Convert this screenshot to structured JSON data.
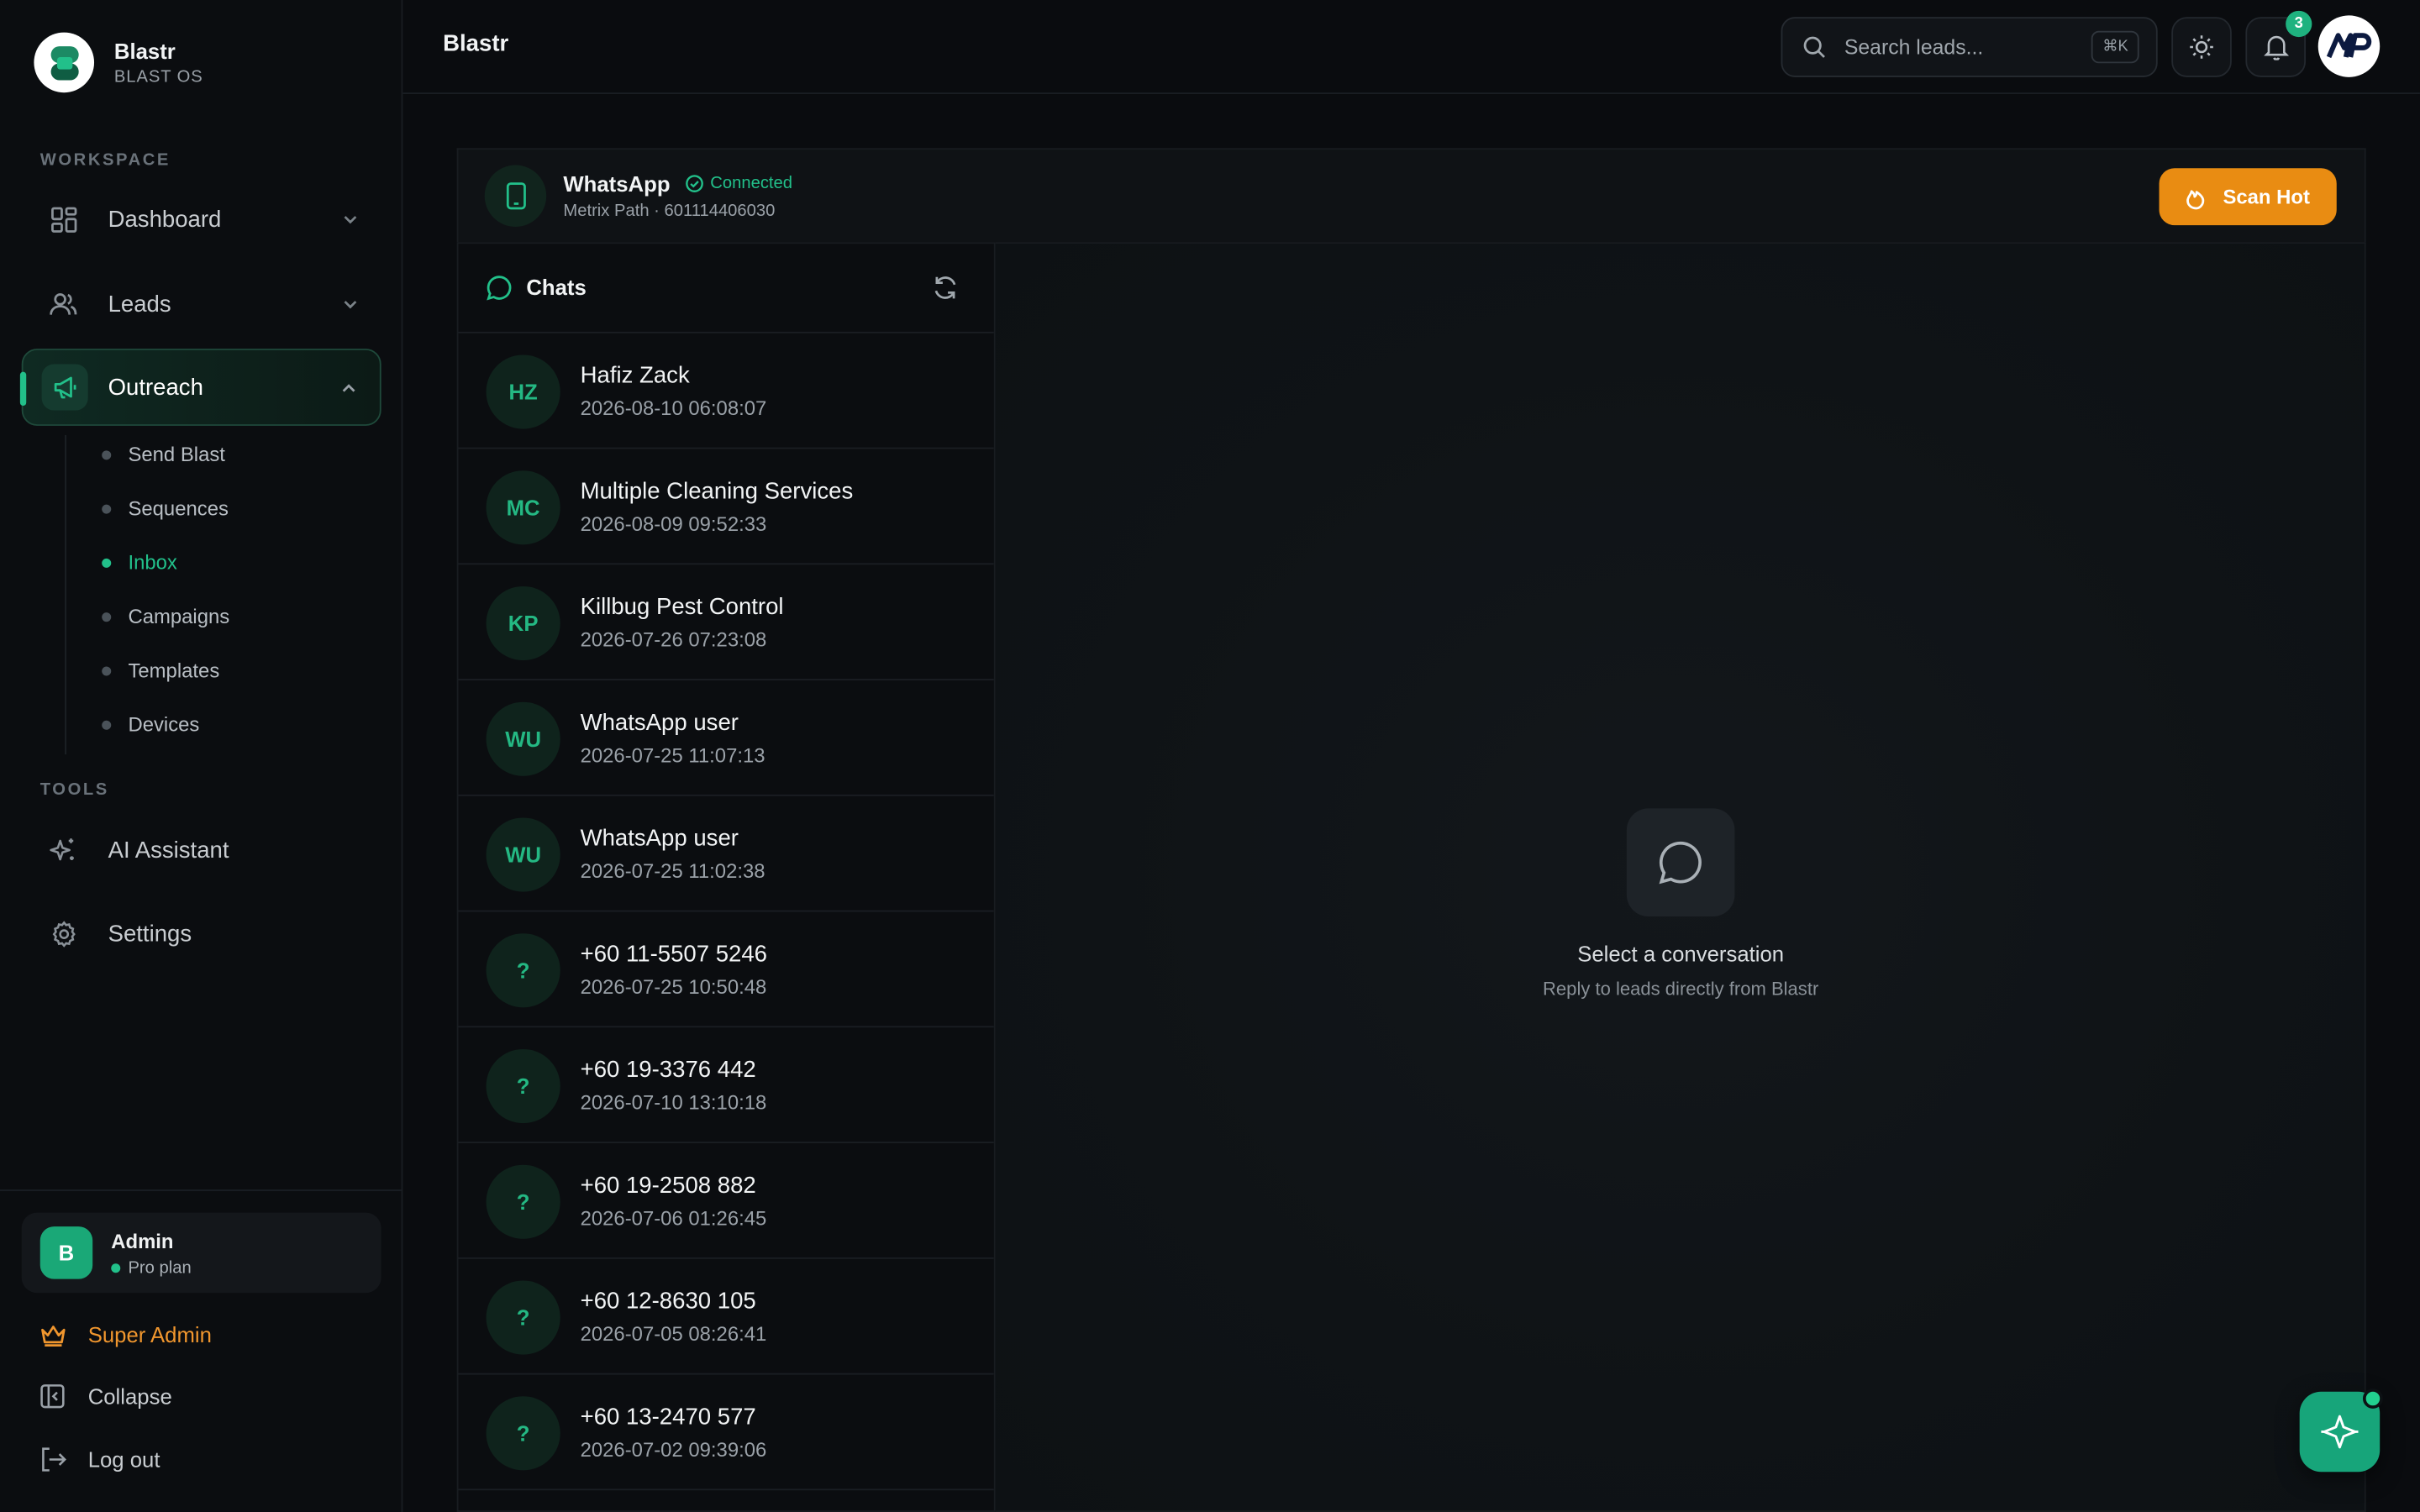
{
  "brand": {
    "name": "Blastr",
    "subtitle": "BLAST OS"
  },
  "sidebar": {
    "workspace_label": "WORKSPACE",
    "tools_label": "TOOLS",
    "items": [
      {
        "label": "Dashboard",
        "icon": "grid-icon"
      },
      {
        "label": "Leads",
        "icon": "users-icon"
      },
      {
        "label": "Outreach",
        "icon": "megaphone-icon",
        "active": true
      }
    ],
    "sub_items": [
      {
        "label": "Send Blast"
      },
      {
        "label": "Sequences"
      },
      {
        "label": "Inbox",
        "active": true
      },
      {
        "label": "Campaigns"
      },
      {
        "label": "Templates"
      },
      {
        "label": "Devices"
      }
    ],
    "tools": [
      {
        "label": "AI Assistant",
        "icon": "sparkles-icon"
      },
      {
        "label": "Settings",
        "icon": "gear-icon"
      }
    ],
    "user": {
      "initial": "B",
      "name": "Admin",
      "plan": "Pro plan"
    },
    "super_admin": "Super Admin",
    "collapse": "Collapse",
    "logout": "Log out"
  },
  "topbar": {
    "title": "Blastr",
    "search_placeholder": "Search leads...",
    "shortcut": "⌘K",
    "notification_count": "3"
  },
  "whatsapp": {
    "title": "WhatsApp",
    "status": "Connected",
    "subtitle": "Metrix Path · 601114406030",
    "scan_button": "Scan Hot"
  },
  "chats": {
    "title": "Chats",
    "rows": [
      {
        "initials": "HZ",
        "name": "Hafiz Zack",
        "time": "2026-08-10 06:08:07"
      },
      {
        "initials": "MC",
        "name": "Multiple Cleaning Services",
        "time": "2026-08-09 09:52:33"
      },
      {
        "initials": "KP",
        "name": "Killbug Pest Control",
        "time": "2026-07-26 07:23:08"
      },
      {
        "initials": "WU",
        "name": "WhatsApp user",
        "time": "2026-07-25 11:07:13"
      },
      {
        "initials": "WU",
        "name": "WhatsApp user",
        "time": "2026-07-25 11:02:38"
      },
      {
        "initials": "?",
        "name": "+60 11-5507 5246",
        "time": "2026-07-25 10:50:48"
      },
      {
        "initials": "?",
        "name": "+60 19-3376 442",
        "time": "2026-07-10 13:10:18"
      },
      {
        "initials": "?",
        "name": "+60 19-2508 882",
        "time": "2026-07-06 01:26:45"
      },
      {
        "initials": "?",
        "name": "+60 12-8630 105",
        "time": "2026-07-05 08:26:41"
      },
      {
        "initials": "?",
        "name": "+60 13-2470 577",
        "time": "2026-07-02 09:39:06"
      }
    ]
  },
  "conversation": {
    "empty_title": "Select a conversation",
    "empty_subtitle": "Reply to leads directly from Blastr"
  },
  "colors": {
    "accent": "#22c08a",
    "orange": "#e98c12",
    "background": "#0a0c0f"
  }
}
